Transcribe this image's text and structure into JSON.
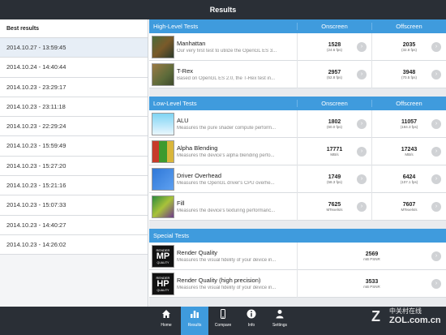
{
  "titlebar": {
    "title": "Results"
  },
  "sidebar": {
    "header": "Best results",
    "items": [
      "2014.10.27 - 13:59:45",
      "2014.10.24 - 14:40:44",
      "2014.10.23 - 23:29:17",
      "2014.10.23 - 23:11:18",
      "2014.10.23 - 22:29:24",
      "2014.10.23 - 15:59:49",
      "2014.10.23 - 15:27:20",
      "2014.10.23 - 15:21:16",
      "2014.10.23 - 15:07:33",
      "2014.10.23 - 14:40:27",
      "2014.10.23 - 14:26:02"
    ]
  },
  "sections": {
    "high": {
      "title": "High-Level Tests",
      "col1": "Onscreen",
      "col2": "Offscreen",
      "rows": [
        {
          "name": "Manhattan",
          "desc": "Our very first test to utilize the OpenGL ES 3...",
          "on": "1528",
          "on_unit": "(24.6 fps)",
          "off": "2035",
          "off_unit": "(32.8 fps)"
        },
        {
          "name": "T-Rex",
          "desc": "Based on OpenGL ES 2.0, the T-Rex test in...",
          "on": "2957",
          "on_unit": "(52.8 fps)",
          "off": "3948",
          "off_unit": "(70.5 fps)"
        }
      ]
    },
    "low": {
      "title": "Low-Level Tests",
      "col1": "Onscreen",
      "col2": "Offscreen",
      "rows": [
        {
          "name": "ALU",
          "desc": "Measures the pure shader compute perform...",
          "on": "1802",
          "on_unit": "(60.0 fps)",
          "off": "11057",
          "off_unit": "(184.3 fps)"
        },
        {
          "name": "Alpha Blending",
          "desc": "Measures the device's alpha blending perfo...",
          "on": "17771",
          "on_unit": "MB/s",
          "off": "17243",
          "off_unit": "MB/s"
        },
        {
          "name": "Driver Overhead",
          "desc": "Measures the OpenGL driver's CPU overhe...",
          "on": "1749",
          "on_unit": "(58.3 fps)",
          "off": "6424",
          "off_unit": "(107.1 fps)"
        },
        {
          "name": "Fill",
          "desc": "Measures the device's texturing performanc...",
          "on": "7625",
          "on_unit": "MTexels/s",
          "off": "7607",
          "off_unit": "MTexels/s"
        }
      ]
    },
    "special": {
      "title": "Special Tests",
      "rows": [
        {
          "name": "Render Quality",
          "desc": "Measures the visual fidelity of your device in...",
          "val": "2569",
          "unit": "mB PSNR",
          "badge_top": "RENDER",
          "badge_big": "MP",
          "badge_bottom": "QUALITY"
        },
        {
          "name": "Render Quality (high precision)",
          "desc": "Measures the visual fidelity of your device in...",
          "val": "3533",
          "unit": "mB PSNR",
          "badge_top": "RENDER",
          "badge_big": "HP",
          "badge_bottom": "QUALITY"
        }
      ]
    }
  },
  "tabs": [
    {
      "label": "Home",
      "icon": "home-icon"
    },
    {
      "label": "Results",
      "icon": "bar-chart-icon"
    },
    {
      "label": "Compare",
      "icon": "phone-icon"
    },
    {
      "label": "Info",
      "icon": "info-icon"
    },
    {
      "label": "Settings",
      "icon": "person-icon"
    }
  ],
  "watermark": {
    "brand": "中关村在线",
    "url": "ZOL.com.cn",
    "logo_letter": "Z"
  }
}
